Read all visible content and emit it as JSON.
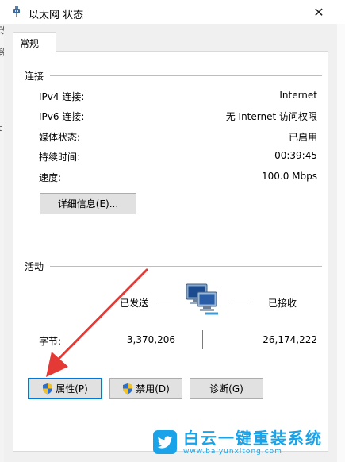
{
  "window": {
    "title": "以太网 状态",
    "close_glyph": "✕"
  },
  "tabs": [
    {
      "label": "常规"
    }
  ],
  "connection": {
    "group_label": "连接",
    "rows": [
      {
        "label": "IPv4 连接:",
        "value": "Internet"
      },
      {
        "label": "IPv6 连接:",
        "value": "无 Internet 访问权限"
      },
      {
        "label": "媒体状态:",
        "value": "已启用"
      },
      {
        "label": "持续时间:",
        "value": "00:39:45"
      },
      {
        "label": "速度:",
        "value": "100.0 Mbps"
      }
    ],
    "details_button": "详细信息(E)..."
  },
  "activity": {
    "group_label": "活动",
    "sent_label": "已发送",
    "received_label": "已接收",
    "bytes_label": "字节:",
    "bytes_sent": "3,370,206",
    "bytes_received": "26,174,222"
  },
  "buttons": {
    "properties": "属性(P)",
    "disable": "禁用(D)",
    "diagnose": "诊断(G)"
  },
  "background": {
    "left_chars": [
      "改",
      "段",
      "t"
    ]
  },
  "watermark": {
    "title": "白云一键重装系统",
    "url": "www.baiyunxitong.com"
  },
  "colors": {
    "accent_blue": "#0078d7",
    "annotation_red": "#e53935",
    "watermark_blue": "#1aa3e8"
  }
}
